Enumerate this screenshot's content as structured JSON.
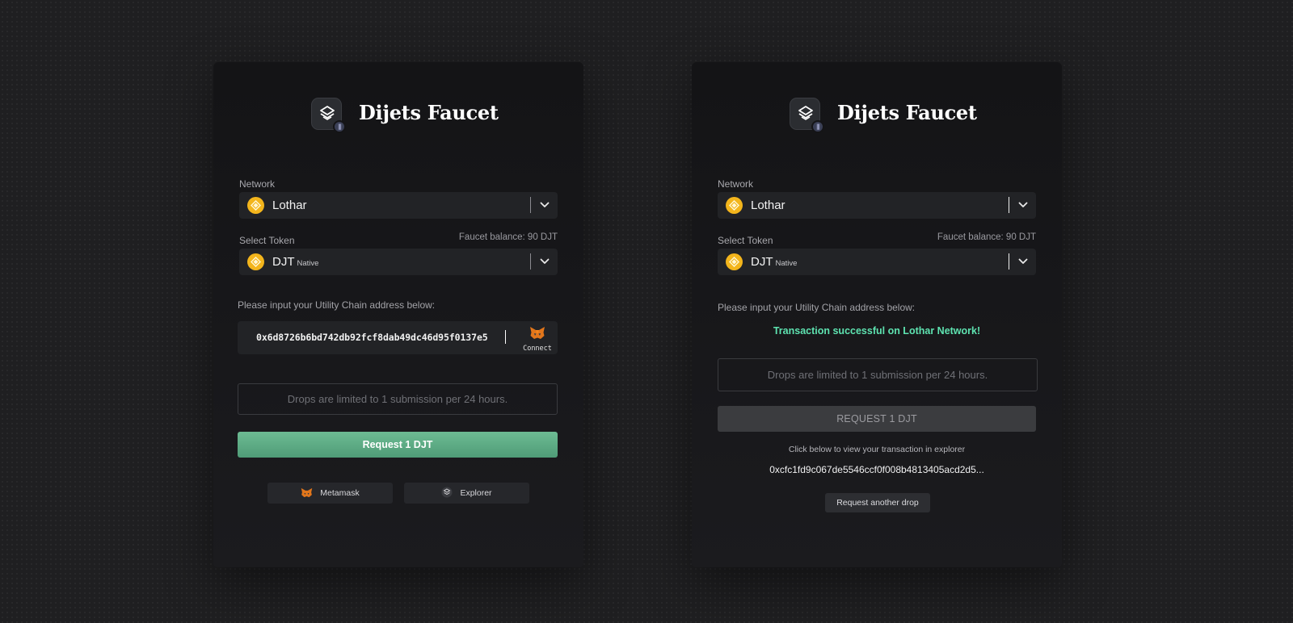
{
  "colors": {
    "background": "#1f1f21",
    "card": "#161618",
    "accent_green": "#5aa882",
    "success_text": "#5ee3b0",
    "token_gold": "#f3b51c"
  },
  "cards": [
    {
      "app_title": "Dijets Faucet",
      "logo_icon": "layers-icon",
      "network_label": "Network",
      "network_value": "Lothar",
      "token_label": "Select Token",
      "faucet_balance": "Faucet balance: 90 DJT",
      "token_value": "DJT",
      "token_sub": "Native",
      "address_prompt": "Please input your Utility Chain address below:",
      "address_value": "0x6d8726b6bd742db92fcf8dab49dc46d95f0137e5",
      "connect_label": "Connect",
      "limit_notice": "Drops are limited to 1 submission per 24 hours.",
      "request_label": "Request 1 DJT",
      "links": [
        {
          "label": "Metamask",
          "icon": "metamask-fox-icon"
        },
        {
          "label": "Explorer",
          "icon": "explorer-icon"
        }
      ]
    },
    {
      "app_title": "Dijets Faucet",
      "logo_icon": "layers-icon",
      "network_label": "Network",
      "network_value": "Lothar",
      "token_label": "Select Token",
      "faucet_balance": "Faucet balance: 90 DJT",
      "token_value": "DJT",
      "token_sub": "Native",
      "address_prompt": "Please input your Utility Chain address below:",
      "success_message": "Transaction successful on Lothar Network!",
      "limit_notice": "Drops are limited to 1 submission per 24 hours.",
      "request_label": "REQUEST 1 DJT",
      "explorer_hint": "Click below to view your transaction in explorer",
      "tx_hash": "0xcfc1fd9c067de5546ccf0f008b4813405acd2d5...",
      "another_drop_label": "Request another drop"
    }
  ]
}
